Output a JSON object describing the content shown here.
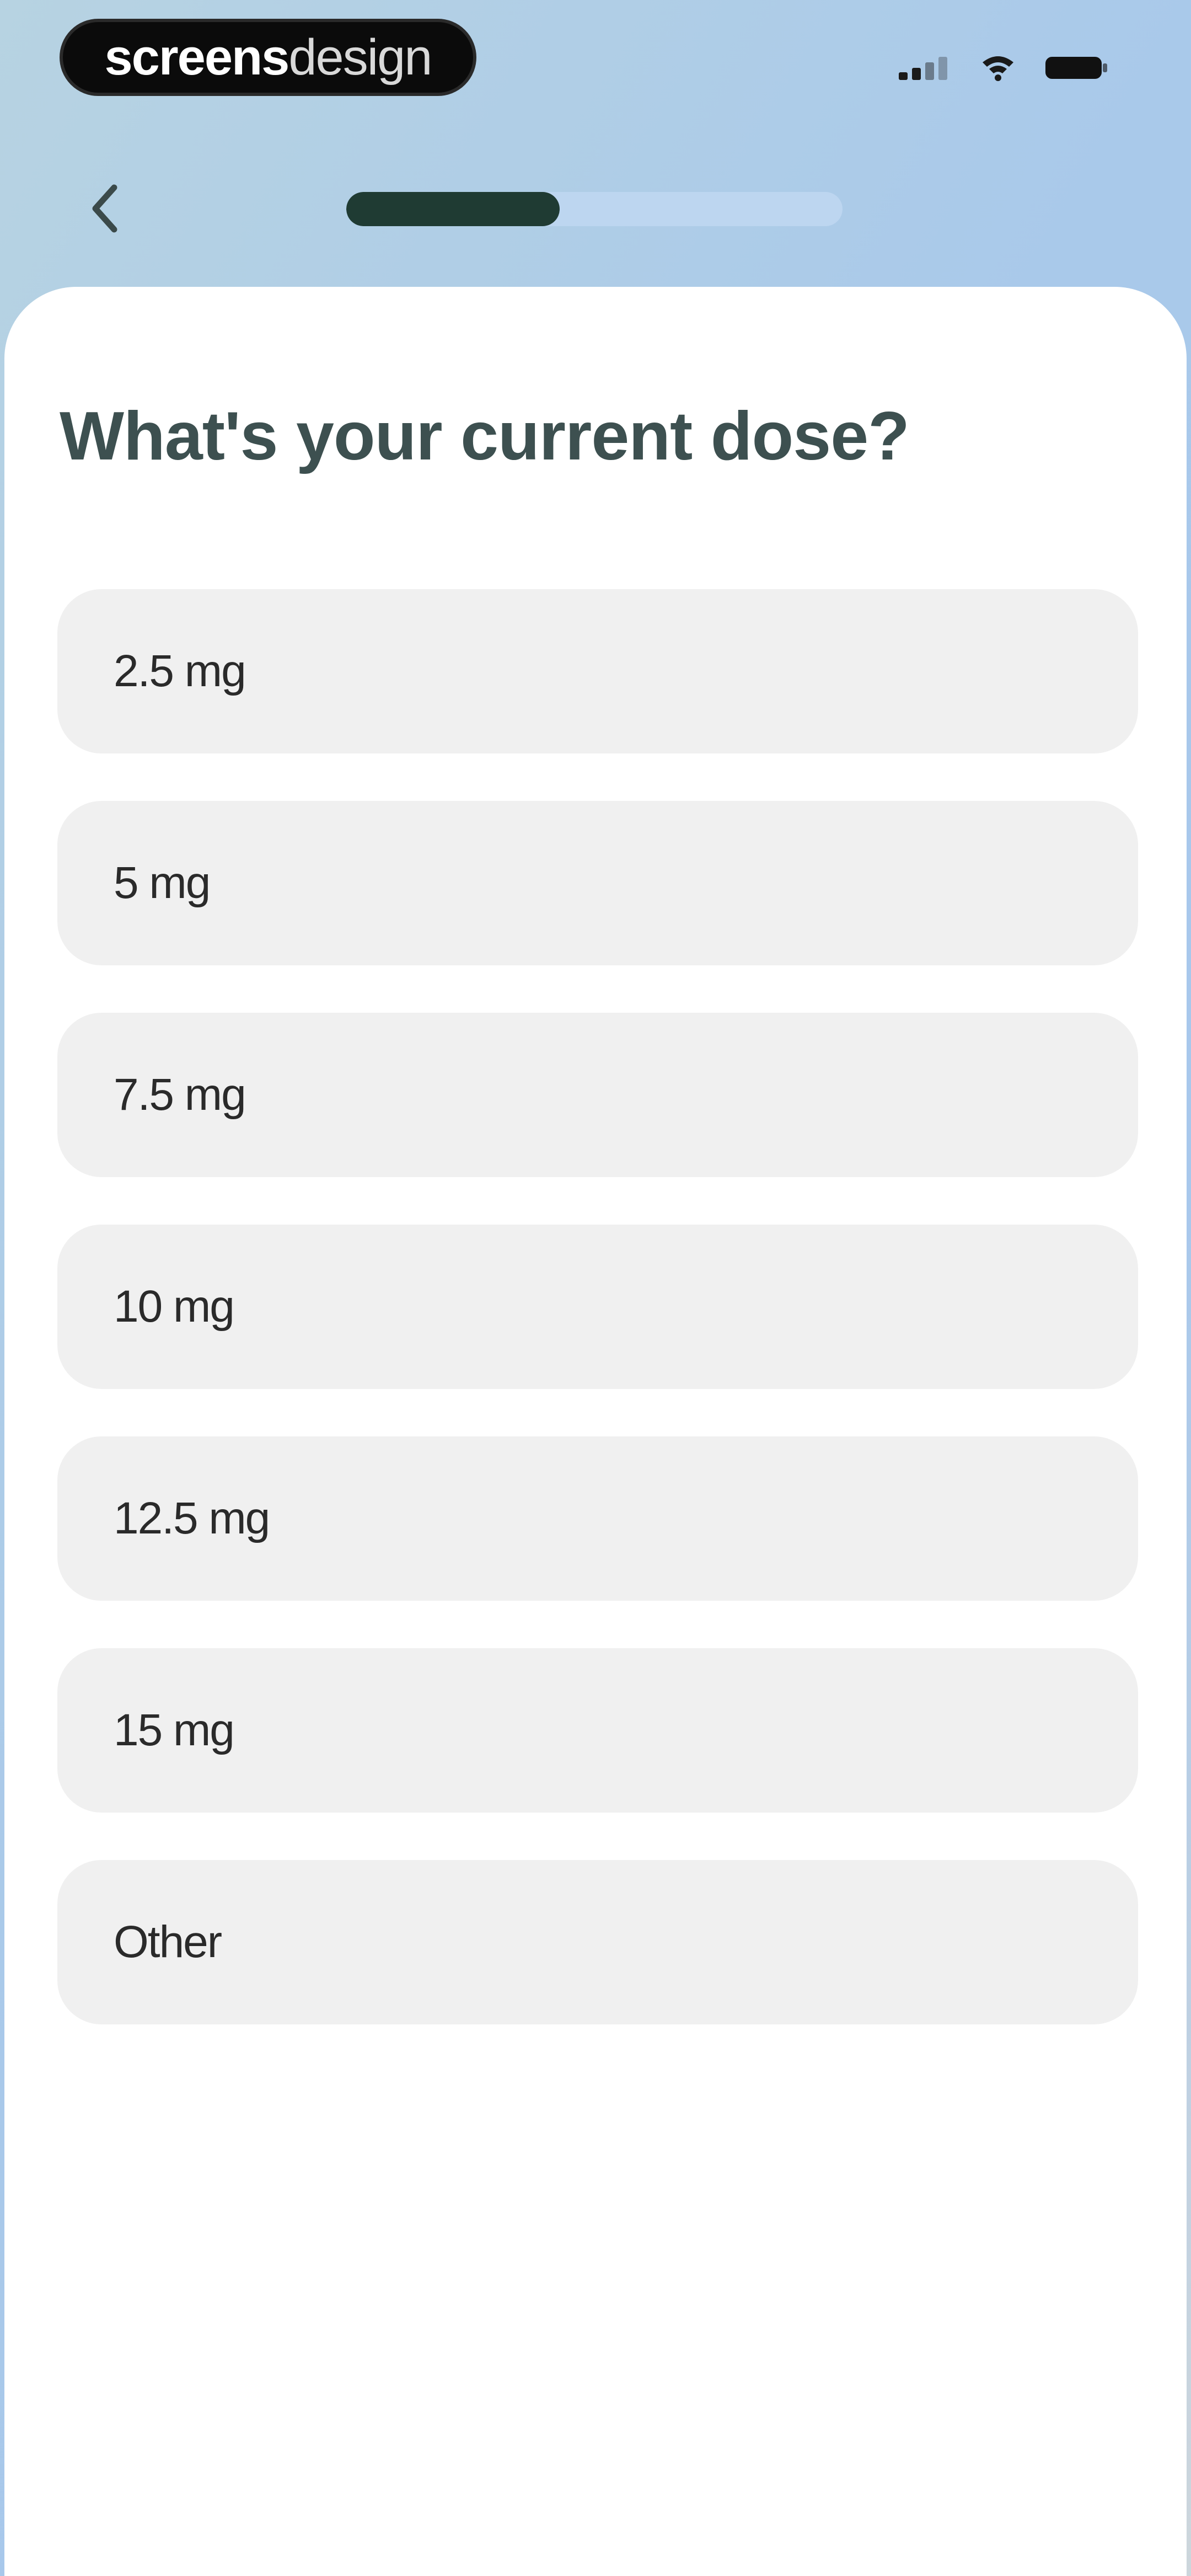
{
  "status_bar": {
    "brand_bold": "screens",
    "brand_light": "design",
    "signal_icon": "signal-icon",
    "wifi_icon": "wifi-icon",
    "battery_icon": "battery-icon"
  },
  "nav": {
    "back_icon": "chevron-left-icon",
    "progress": 0.43,
    "progress_color": "#1f3b33"
  },
  "question": "What's your current dose?",
  "options": [
    {
      "label": "2.5 mg"
    },
    {
      "label": "5 mg"
    },
    {
      "label": "7.5 mg"
    },
    {
      "label": "10 mg"
    },
    {
      "label": "12.5 mg"
    },
    {
      "label": "15 mg"
    },
    {
      "label": "Other"
    }
  ],
  "colors": {
    "option_bg": "#f0f0f0",
    "question_text": "#3d5050",
    "header_gradient_start": "#b7d3e2",
    "header_gradient_end": "#cdd6dc"
  }
}
